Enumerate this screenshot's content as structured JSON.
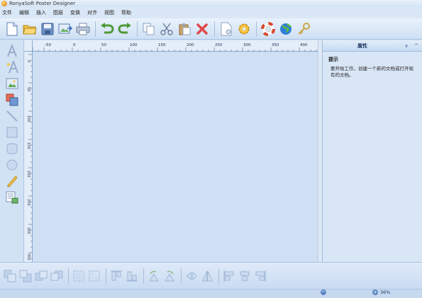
{
  "window": {
    "title": "RonyaSoft Poster Designer"
  },
  "menu": [
    {
      "label": "文件"
    },
    {
      "label": "编辑"
    },
    {
      "label": "插入"
    },
    {
      "label": "图层"
    },
    {
      "label": "变换"
    },
    {
      "label": "对齐"
    },
    {
      "label": "视图"
    },
    {
      "label": "帮助"
    }
  ],
  "ruler": {
    "top_labels": [
      "-50",
      "0",
      "50",
      "100",
      "150",
      "200",
      "250",
      "300",
      "350",
      "400"
    ],
    "left_labels": [
      "0",
      "50",
      "100",
      "150",
      "200",
      "250",
      "300",
      "350"
    ]
  },
  "panel": {
    "title": "属性",
    "collapse_glyph": "∨",
    "pin_glyph": "^",
    "hint_title": "提示",
    "hint_text": "要开始工作，创建一个新的文档或打开现有的文档。"
  },
  "status": {
    "zoom": "36%"
  },
  "colors": {
    "accent": "#3a6fb7",
    "background": "#cfe0f4"
  }
}
